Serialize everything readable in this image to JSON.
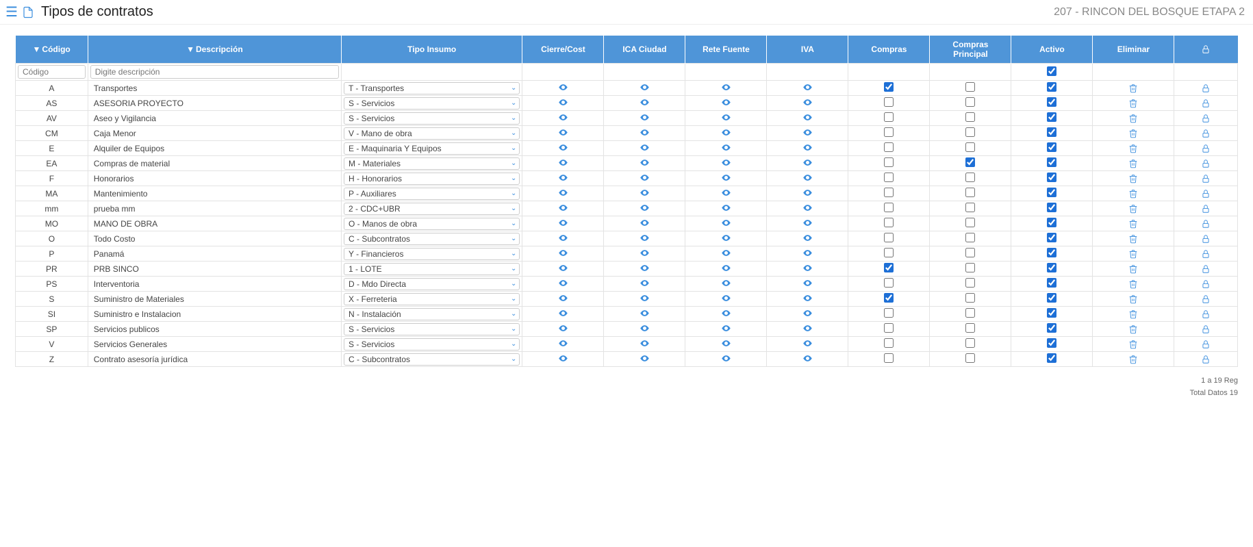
{
  "header": {
    "title": "Tipos de contratos",
    "project": "207 - RINCON DEL BOSQUE ETAPA 2"
  },
  "columns": {
    "codigo": "Código",
    "descripcion": "Descripción",
    "tipo_insumo": "Tipo Insumo",
    "cierre_cost": "Cierre/Cost",
    "ica_ciudad": "ICA Ciudad",
    "rete_fuente": "Rete Fuente",
    "iva": "IVA",
    "compras": "Compras",
    "compras_principal": "Compras Principal",
    "activo": "Activo",
    "eliminar": "Eliminar"
  },
  "filters": {
    "codigo_placeholder": "Código",
    "descripcion_placeholder": "Digite descripción"
  },
  "filter_row_activo_checked": true,
  "rows": [
    {
      "codigo": "A",
      "descripcion": "Transportes",
      "tipo": "T - Transportes",
      "compras": true,
      "compras_principal": false,
      "activo": true
    },
    {
      "codigo": "AS",
      "descripcion": "ASESORIA PROYECTO",
      "tipo": "S - Servicios",
      "compras": false,
      "compras_principal": false,
      "activo": true
    },
    {
      "codigo": "AV",
      "descripcion": "Aseo y Vigilancia",
      "tipo": "S - Servicios",
      "compras": false,
      "compras_principal": false,
      "activo": true
    },
    {
      "codigo": "CM",
      "descripcion": "Caja Menor",
      "tipo": "V - Mano de obra",
      "compras": false,
      "compras_principal": false,
      "activo": true
    },
    {
      "codigo": "E",
      "descripcion": "Alquiler de Equipos",
      "tipo": "E - Maquinaria Y Equipos",
      "compras": false,
      "compras_principal": false,
      "activo": true
    },
    {
      "codigo": "EA",
      "descripcion": "Compras de material",
      "tipo": "M - Materiales",
      "compras": false,
      "compras_principal": true,
      "activo": true
    },
    {
      "codigo": "F",
      "descripcion": "Honorarios",
      "tipo": "H - Honorarios",
      "compras": false,
      "compras_principal": false,
      "activo": true
    },
    {
      "codigo": "MA",
      "descripcion": "Mantenimiento",
      "tipo": "P - Auxiliares",
      "compras": false,
      "compras_principal": false,
      "activo": true
    },
    {
      "codigo": "mm",
      "descripcion": "prueba mm",
      "tipo": "2 - CDC+UBR",
      "compras": false,
      "compras_principal": false,
      "activo": true
    },
    {
      "codigo": "MO",
      "descripcion": "MANO DE OBRA",
      "tipo": "O - Manos de obra",
      "compras": false,
      "compras_principal": false,
      "activo": true
    },
    {
      "codigo": "O",
      "descripcion": "Todo Costo",
      "tipo": "C - Subcontratos",
      "compras": false,
      "compras_principal": false,
      "activo": true
    },
    {
      "codigo": "P",
      "descripcion": "Panamá",
      "tipo": "Y - Financieros",
      "compras": false,
      "compras_principal": false,
      "activo": true
    },
    {
      "codigo": "PR",
      "descripcion": "PRB SINCO",
      "tipo": "1 - LOTE",
      "compras": true,
      "compras_principal": false,
      "activo": true
    },
    {
      "codigo": "PS",
      "descripcion": "Interventoria",
      "tipo": "D - Mdo Directa",
      "compras": false,
      "compras_principal": false,
      "activo": true
    },
    {
      "codigo": "S",
      "descripcion": "Suministro de Materiales",
      "tipo": "X - Ferreteria",
      "compras": true,
      "compras_principal": false,
      "activo": true
    },
    {
      "codigo": "SI",
      "descripcion": "Suministro e Instalacion",
      "tipo": "N - Instalación",
      "compras": false,
      "compras_principal": false,
      "activo": true
    },
    {
      "codigo": "SP",
      "descripcion": "Servicios publicos",
      "tipo": "S - Servicios",
      "compras": false,
      "compras_principal": false,
      "activo": true
    },
    {
      "codigo": "V",
      "descripcion": "Servicios Generales",
      "tipo": "S - Servicios",
      "compras": false,
      "compras_principal": false,
      "activo": true
    },
    {
      "codigo": "Z",
      "descripcion": "Contrato asesoría jurídica",
      "tipo": "C - Subcontratos",
      "compras": false,
      "compras_principal": false,
      "activo": true
    }
  ],
  "footer": {
    "range": "1 a 19 Reg",
    "total": "Total Datos 19"
  }
}
